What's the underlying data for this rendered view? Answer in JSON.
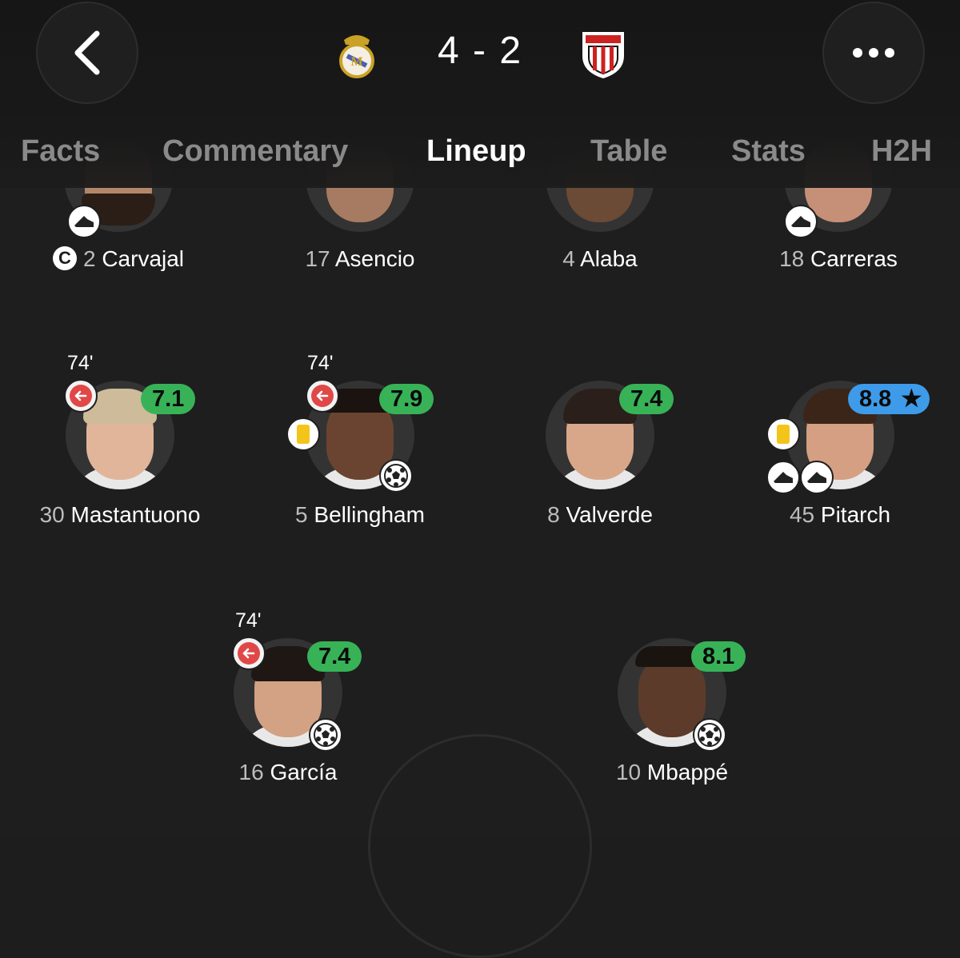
{
  "header": {
    "score": "4 - 2",
    "home_crest": "real-madrid-crest",
    "away_crest": "athletic-club-crest",
    "tabs": [
      "Facts",
      "Commentary",
      "Lineup",
      "Table",
      "Stats",
      "H2H"
    ],
    "active_tab": "Lineup"
  },
  "colors": {
    "rating_green": "#38b257",
    "rating_top": "#3e9be9",
    "sub_red": "#e04848",
    "yellow_card": "#f3c51b"
  },
  "defenders": [
    {
      "number": "2",
      "name": "Carvajal",
      "captain": "C"
    },
    {
      "number": "17",
      "name": "Asencio"
    },
    {
      "number": "4",
      "name": "Alaba"
    },
    {
      "number": "18",
      "name": "Carreras"
    }
  ],
  "midfielders": [
    {
      "number": "30",
      "name": "Mastantuono",
      "rating": "7.1",
      "sub_minute": "74'"
    },
    {
      "number": "5",
      "name": "Bellingham",
      "rating": "7.9",
      "sub_minute": "74'"
    },
    {
      "number": "8",
      "name": "Valverde",
      "rating": "7.4"
    },
    {
      "number": "45",
      "name": "Pitarch",
      "rating": "8.8"
    }
  ],
  "forwards": [
    {
      "number": "16",
      "name": "García",
      "rating": "7.4",
      "sub_minute": "74'"
    },
    {
      "number": "10",
      "name": "Mbappé",
      "rating": "8.1"
    }
  ]
}
